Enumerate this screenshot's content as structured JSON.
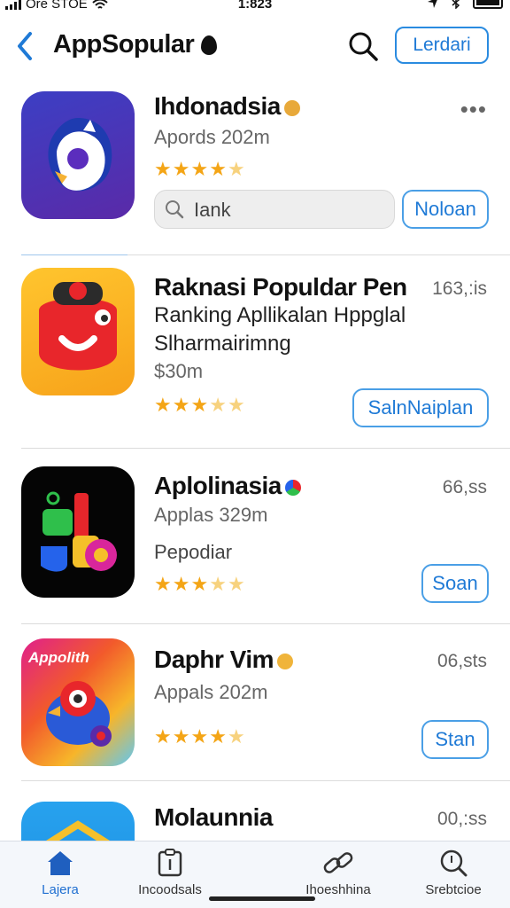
{
  "status_bar": {
    "carrier": "Ore STOE",
    "time": "1:823"
  },
  "nav": {
    "title": "AppSopular",
    "action_label": "Lerdari"
  },
  "apps": [
    {
      "name": "Ihdonadsia",
      "subtitle": "Apords 202m",
      "rating": 4.5,
      "search_placeholder": "Iank",
      "action_label": "Noloan"
    },
    {
      "name": "Raknasi Populdar Pen",
      "meta": "163,:is",
      "description_line1": "Ranking Apllikalan Hppglal",
      "description_line2": "Slharmairimng",
      "price": "$30m",
      "rating": 3.5,
      "action_label": "SalnNaiplan"
    },
    {
      "name": "Aplolinasia",
      "meta": "66,ss",
      "subtitle": "Applas 329m",
      "note": "Pepodiar",
      "rating": 3.5,
      "action_label": "Soan"
    },
    {
      "name": "Daphr Vim",
      "meta": "06,sts",
      "subtitle": "Appals 202m",
      "icon_caption": "Appolith",
      "rating": 4.5,
      "action_label": "Stan"
    },
    {
      "name": "Molaunnia",
      "meta": "00,:ss"
    }
  ],
  "tabs": [
    {
      "label": "Lajera",
      "icon": "home-icon",
      "active": true
    },
    {
      "label": "Incoodsals",
      "icon": "clipboard-icon",
      "active": false
    },
    {
      "label": "Ihoeshhina",
      "icon": "link-icon",
      "active": false
    },
    {
      "label": "Srebtcioe",
      "icon": "search-icon",
      "active": false
    }
  ],
  "colors": {
    "accent": "#1f7ad6",
    "star": "#f4a516"
  }
}
